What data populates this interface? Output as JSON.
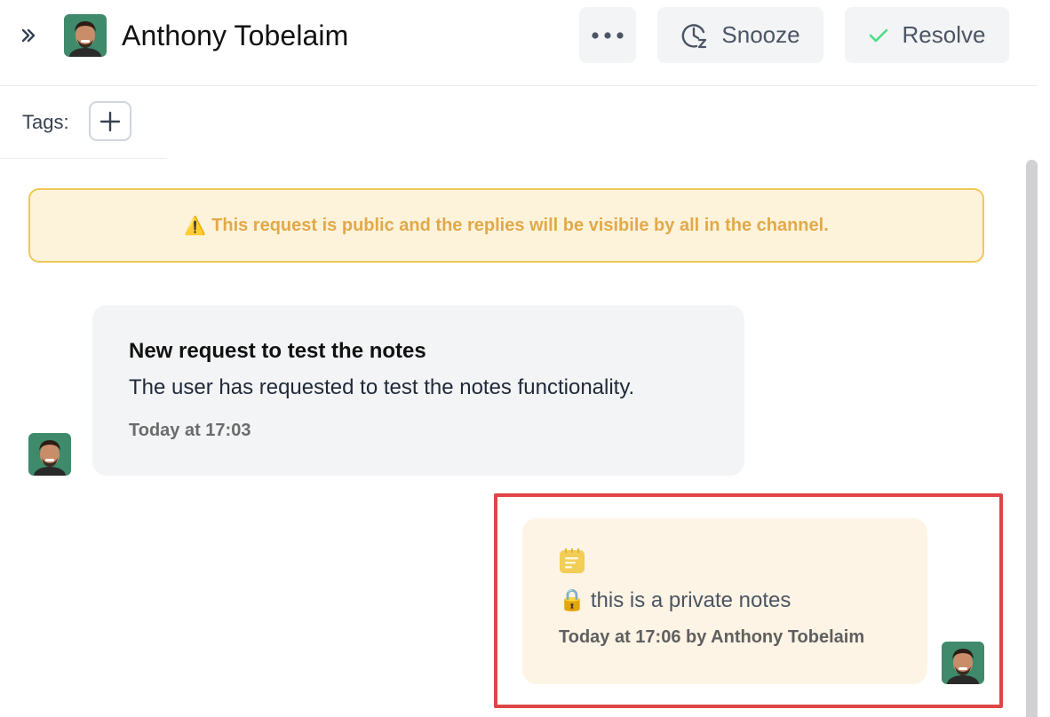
{
  "header": {
    "contact_name": "Anthony Tobelaim",
    "snooze_label": "Snooze",
    "resolve_label": "Resolve",
    "icons": {
      "expand": "chevrons-right-icon",
      "more": "more-horizontal-icon",
      "snooze": "clock-snooze-icon",
      "resolve": "check-icon"
    }
  },
  "tags": {
    "label": "Tags:",
    "add_icon": "plus-icon"
  },
  "warning": {
    "icon": "⚠️",
    "text": "This request is public and the replies will be visibile by all in the channel."
  },
  "messages": [
    {
      "direction": "incoming",
      "title": "New request to test the notes",
      "body": "The user has requested to test the notes functionality.",
      "time": "Today at 17:03"
    },
    {
      "direction": "outgoing",
      "type": "private-note",
      "lock_icon": "🔒",
      "text": "this is a private notes",
      "meta": "Today at 17:06 by Anthony Tobelaim"
    }
  ],
  "colors": {
    "warning_bg": "#fdf3da",
    "warning_border": "#f1c757",
    "warning_text": "#e2a94a",
    "note_bg": "#fdf4e5",
    "highlight": "#df4545",
    "check_green": "#4ade80",
    "avatar_bg": "#3f8a6b"
  }
}
